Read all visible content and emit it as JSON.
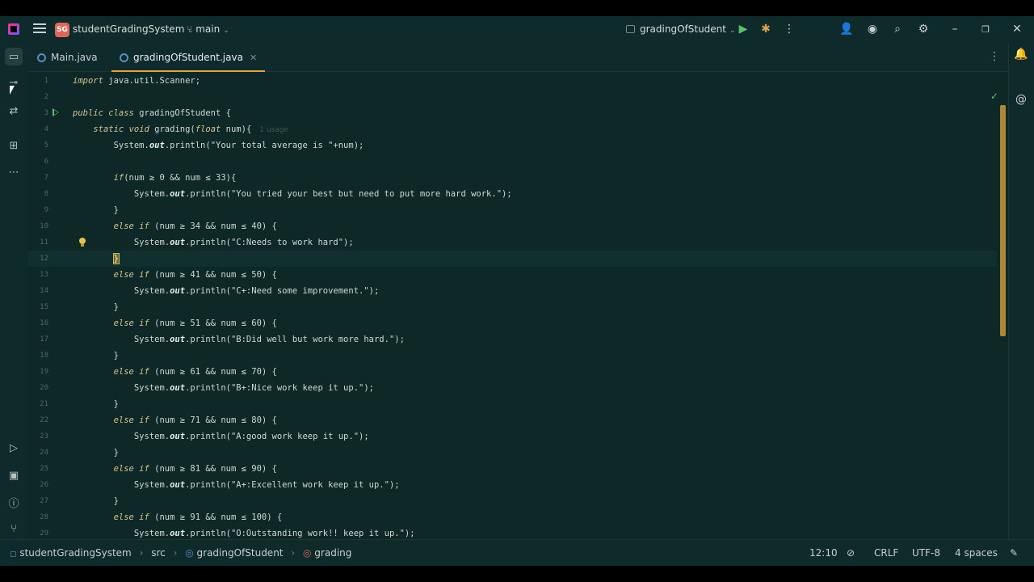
{
  "titlebar": {
    "project_badge": "SG",
    "project_name": "studentGradingSystem",
    "branch": "main",
    "run_config": "gradingOfStudent"
  },
  "tabs": [
    {
      "label": "Main.java",
      "active": false
    },
    {
      "label": "gradingOfStudent.java",
      "active": true
    }
  ],
  "editor": {
    "usage_hint": "1 usage",
    "lines": [
      {
        "n": "1",
        "html": "<span class='kw'>import</span> java.util.Scanner;"
      },
      {
        "n": "2",
        "html": ""
      },
      {
        "n": "3",
        "html": "<span class='kw'>public class</span> gradingOfStudent {"
      },
      {
        "n": "4",
        "html": "    <span class='kw'>static void</span> grading(<span class='kw'>float</span> num){"
      },
      {
        "n": "5",
        "html": "        System.<span class='fld'>out</span>.println(\"Your total average is \"+num);"
      },
      {
        "n": "6",
        "html": ""
      },
      {
        "n": "7",
        "html": "        <span class='kw'>if</span>(num ≥ 0 && num ≤ 33){"
      },
      {
        "n": "8",
        "html": "            System.<span class='fld'>out</span>.println(\"You tried your best but need to put more hard work.\");"
      },
      {
        "n": "9",
        "html": "        }"
      },
      {
        "n": "10",
        "html": "        <span class='kw'>else if</span> (num ≥ 34 && num ≤ 40) {"
      },
      {
        "n": "11",
        "html": "            System.<span class='fld'>out</span>.println(\"C:Needs to work hard\");"
      },
      {
        "n": "12",
        "html": "        <span class='cursor-brace'>}</span>"
      },
      {
        "n": "13",
        "html": "        <span class='kw'>else if</span> (num ≥ 41 && num ≤ 50) {"
      },
      {
        "n": "14",
        "html": "            System.<span class='fld'>out</span>.println(\"C+:Need some improvement.\");"
      },
      {
        "n": "15",
        "html": "        }"
      },
      {
        "n": "16",
        "html": "        <span class='kw'>else if</span> (num ≥ 51 && num ≤ 60) {"
      },
      {
        "n": "17",
        "html": "            System.<span class='fld'>out</span>.println(\"B:Did well but work more hard.\");"
      },
      {
        "n": "18",
        "html": "        }"
      },
      {
        "n": "19",
        "html": "        <span class='kw'>else if</span> (num ≥ 61 && num ≤ 70) {"
      },
      {
        "n": "20",
        "html": "            System.<span class='fld'>out</span>.println(\"B+:Nice work keep it up.\");"
      },
      {
        "n": "21",
        "html": "        }"
      },
      {
        "n": "22",
        "html": "        <span class='kw'>else if</span> (num ≥ 71 && num ≤ 80) {"
      },
      {
        "n": "23",
        "html": "            System.<span class='fld'>out</span>.println(\"A:good work keep it up.\");"
      },
      {
        "n": "24",
        "html": "        }"
      },
      {
        "n": "25",
        "html": "        <span class='kw'>else if</span> (num ≥ 81 && num ≤ 90) {"
      },
      {
        "n": "26",
        "html": "            System.<span class='fld'>out</span>.println(\"A+:Excellent work keep it up.\");"
      },
      {
        "n": "27",
        "html": "        }"
      },
      {
        "n": "28",
        "html": "        <span class='kw'>else if</span> (num ≥ 91 && num ≤ 100) {"
      },
      {
        "n": "29",
        "html": "            System.<span class='fld'>out</span>.println(\"O:Outstanding work!! keep it up.\");"
      }
    ]
  },
  "statusbar": {
    "breadcrumb": [
      "studentGradingSystem",
      "src",
      "gradingOfStudent",
      "grading"
    ],
    "position": "12:10",
    "line_ending": "CRLF",
    "encoding": "UTF-8",
    "indent": "4 spaces"
  },
  "colors": {
    "background": "#0f2a2a",
    "accent": "#e6a23c",
    "run_green": "#5cbf6a"
  }
}
